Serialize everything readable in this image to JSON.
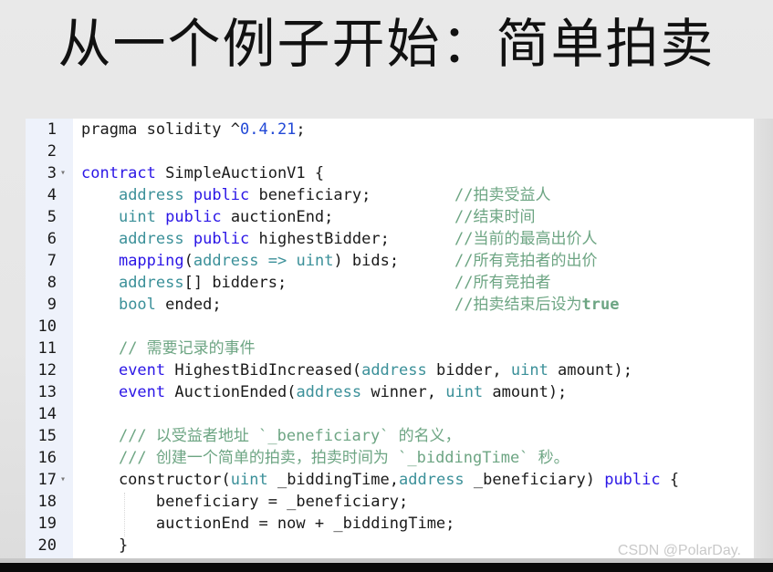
{
  "slide": {
    "title": "从一个例子开始：简单拍卖"
  },
  "watermark": "CSDN @PolarDay.",
  "colors": {
    "keyword": "#2b16e6",
    "type": "#3b9099",
    "number": "#2148d6",
    "comment": "#6da583",
    "gutter_bg": "#eef2fb",
    "text": "#1a1a1a"
  },
  "code": {
    "lines": [
      {
        "n": "1",
        "fold": false,
        "tokens": [
          [
            "t",
            "pragma solidity ^"
          ],
          [
            "num",
            "0.4.21"
          ],
          [
            "t",
            ";"
          ]
        ]
      },
      {
        "n": "2",
        "fold": false,
        "tokens": []
      },
      {
        "n": "3",
        "fold": true,
        "tokens": [
          [
            "kw",
            "contract"
          ],
          [
            "t",
            " SimpleAuctionV1 {"
          ]
        ]
      },
      {
        "n": "4",
        "fold": false,
        "tokens": [
          [
            "t",
            "    "
          ],
          [
            "ty",
            "address"
          ],
          [
            "t",
            " "
          ],
          [
            "kw",
            "public"
          ],
          [
            "t",
            " beneficiary;"
          ]
        ],
        "comment": "//拍卖受益人"
      },
      {
        "n": "5",
        "fold": false,
        "tokens": [
          [
            "t",
            "    "
          ],
          [
            "ty",
            "uint"
          ],
          [
            "t",
            " "
          ],
          [
            "kw",
            "public"
          ],
          [
            "t",
            " auctionEnd;"
          ]
        ],
        "comment": "//结束时间"
      },
      {
        "n": "6",
        "fold": false,
        "tokens": [
          [
            "t",
            "    "
          ],
          [
            "ty",
            "address"
          ],
          [
            "t",
            " "
          ],
          [
            "kw",
            "public"
          ],
          [
            "t",
            " highestBidder;"
          ]
        ],
        "comment": "//当前的最高出价人"
      },
      {
        "n": "7",
        "fold": false,
        "tokens": [
          [
            "t",
            "    "
          ],
          [
            "kw",
            "mapping"
          ],
          [
            "t",
            "("
          ],
          [
            "ty",
            "address"
          ],
          [
            "t",
            " "
          ],
          [
            "ty",
            "=>"
          ],
          [
            "t",
            " "
          ],
          [
            "ty",
            "uint"
          ],
          [
            "t",
            ") bids;"
          ]
        ],
        "comment": "//所有竞拍者的出价"
      },
      {
        "n": "8",
        "fold": false,
        "tokens": [
          [
            "t",
            "    "
          ],
          [
            "ty",
            "address"
          ],
          [
            "t",
            "[] bidders;"
          ]
        ],
        "comment": "//所有竞拍者"
      },
      {
        "n": "9",
        "fold": false,
        "tokens": [
          [
            "t",
            "    "
          ],
          [
            "ty",
            "bool"
          ],
          [
            "t",
            " ended;"
          ]
        ],
        "comment": "//拍卖结束后设为",
        "comment_bold": "true"
      },
      {
        "n": "10",
        "fold": false,
        "tokens": []
      },
      {
        "n": "11",
        "fold": false,
        "tokens": [
          [
            "t",
            "    "
          ],
          [
            "cm",
            "// 需要记录的事件"
          ]
        ]
      },
      {
        "n": "12",
        "fold": false,
        "tokens": [
          [
            "t",
            "    "
          ],
          [
            "kw",
            "event"
          ],
          [
            "t",
            " HighestBidIncreased("
          ],
          [
            "ty",
            "address"
          ],
          [
            "t",
            " bidder, "
          ],
          [
            "ty",
            "uint"
          ],
          [
            "t",
            " amount);"
          ]
        ]
      },
      {
        "n": "13",
        "fold": false,
        "tokens": [
          [
            "t",
            "    "
          ],
          [
            "kw",
            "event"
          ],
          [
            "t",
            " AuctionEnded("
          ],
          [
            "ty",
            "address"
          ],
          [
            "t",
            " winner, "
          ],
          [
            "ty",
            "uint"
          ],
          [
            "t",
            " amount);"
          ]
        ]
      },
      {
        "n": "14",
        "fold": false,
        "tokens": []
      },
      {
        "n": "15",
        "fold": false,
        "tokens": [
          [
            "t",
            "    "
          ],
          [
            "cm",
            "/// 以受益者地址 `_beneficiary` 的名义，"
          ]
        ]
      },
      {
        "n": "16",
        "fold": false,
        "tokens": [
          [
            "t",
            "    "
          ],
          [
            "cm",
            "/// 创建一个简单的拍卖，拍卖时间为 `_biddingTime` 秒。"
          ]
        ]
      },
      {
        "n": "17",
        "fold": true,
        "tokens": [
          [
            "t",
            "    constructor("
          ],
          [
            "ty",
            "uint"
          ],
          [
            "t",
            " _biddingTime,"
          ],
          [
            "ty",
            "address"
          ],
          [
            "t",
            " _beneficiary) "
          ],
          [
            "kw",
            "public"
          ],
          [
            "t",
            " {"
          ]
        ]
      },
      {
        "n": "18",
        "fold": false,
        "tokens": [
          [
            "t",
            "        beneficiary = _beneficiary;"
          ]
        ]
      },
      {
        "n": "19",
        "fold": false,
        "tokens": [
          [
            "t",
            "        auctionEnd = now + _biddingTime;"
          ]
        ]
      },
      {
        "n": "20",
        "fold": false,
        "tokens": [
          [
            "t",
            "    }"
          ]
        ]
      }
    ]
  }
}
